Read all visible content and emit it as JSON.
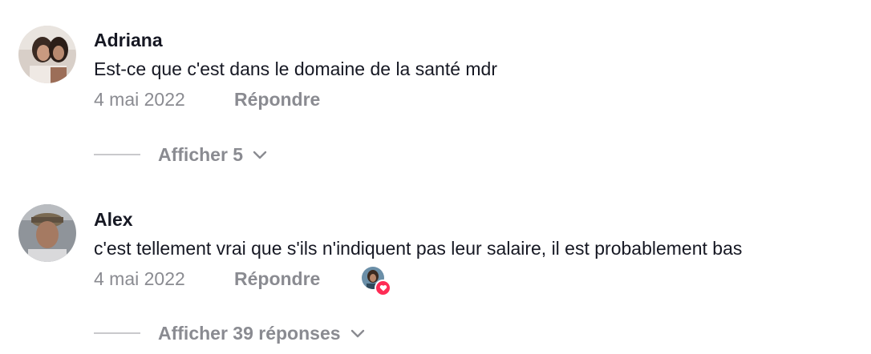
{
  "comments": [
    {
      "username": "Adriana",
      "text": "Est-ce que c'est dans le domaine de la santé mdr",
      "date": "4 mai 2022",
      "reply_label": "Répondre",
      "view_replies_label": "Afficher 5"
    },
    {
      "username": "Alex",
      "text": "c'est tellement vrai que s'ils n'indiquent pas leur salaire, il est probablement bas",
      "date": "4 mai 2022",
      "reply_label": "Répondre",
      "view_replies_label": "Afficher 39 réponses"
    }
  ],
  "icons": {
    "chevron": "chevron-down-icon",
    "heart": "heart-icon"
  },
  "colors": {
    "text_primary": "#161823",
    "text_secondary": "#8a8b91",
    "like_badge": "#fe2c55"
  }
}
